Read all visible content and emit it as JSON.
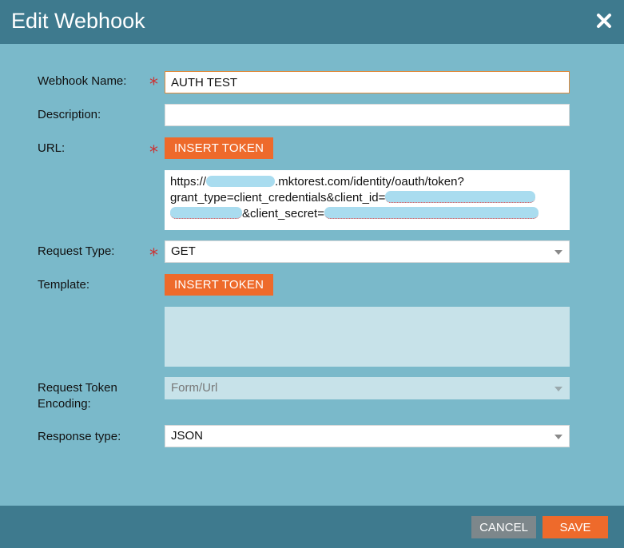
{
  "dialog": {
    "title": "Edit Webhook",
    "close_icon": "close-icon"
  },
  "form": {
    "required_mark": "*",
    "webhook_name": {
      "label": "Webhook Name:",
      "value": "AUTH TEST"
    },
    "description": {
      "label": "Description:",
      "value": ""
    },
    "url": {
      "label": "URL:",
      "insert_token_label": "INSERT TOKEN",
      "line1_prefix": "https://",
      "line1_suffix": ".mktorest.com/identity/oauth/token?",
      "line2": "grant_type=client_credentials&client_id=",
      "line3": "&client_secret="
    },
    "request_type": {
      "label": "Request Type:",
      "value": "GET"
    },
    "template": {
      "label": "Template:",
      "insert_token_label": "INSERT TOKEN",
      "value": ""
    },
    "request_token_encoding": {
      "label_line1": "Request Token",
      "label_line2": "Encoding:",
      "value": "Form/Url"
    },
    "response_type": {
      "label": "Response type:",
      "value": "JSON"
    }
  },
  "footer": {
    "cancel_label": "CANCEL",
    "save_label": "SAVE"
  },
  "colors": {
    "header_bg": "#3e7a8e",
    "body_bg": "#7ab9ca",
    "accent_orange": "#ee6a2b",
    "cancel_gray": "#7d878b",
    "required_red": "#cc3333",
    "redaction_blue": "#a9dcef"
  }
}
